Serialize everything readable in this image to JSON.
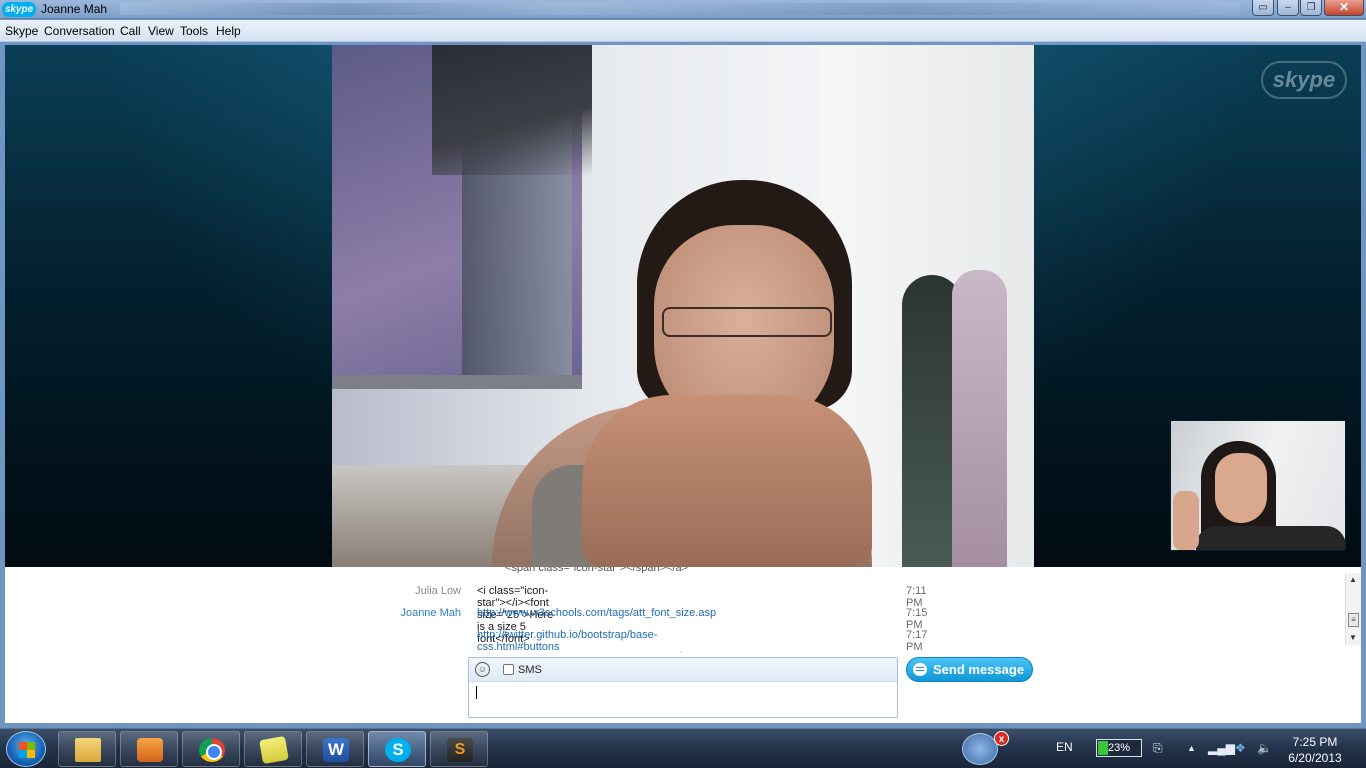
{
  "window": {
    "app_logo": "skype",
    "title": "Joanne Mah",
    "controls": [
      "restore-down-icon",
      "minimize-icon",
      "maximize-icon",
      "close-icon"
    ]
  },
  "menu": [
    "Skype",
    "Conversation",
    "Call",
    "View",
    "Tools",
    "Help"
  ],
  "video": {
    "watermark": "skype"
  },
  "chat": {
    "cut_line": "<span class=\"icon-star\"></span></a>",
    "messages": [
      {
        "sender": "Julia Low",
        "text": "<i class=\"icon-star\"></i><font size=\"25\">Here is a size 5 font</font>",
        "time": "7:11 PM",
        "sender_color": "#8a8a8a",
        "text_color": "#1a1a1a"
      },
      {
        "sender": "Joanne Mah",
        "text": "http://www.w3schools.com/tags/att_font_size.asp",
        "time": "7:15 PM",
        "sender_color": "#2f7fc4",
        "text_color": "#1f6db3"
      },
      {
        "sender": "",
        "text": "http://twitter.github.io/bootstrap/base-css.html#buttons",
        "time": "7:17 PM",
        "sender_color": "#2f7fc4",
        "text_color": "#1f6db3"
      }
    ]
  },
  "compose": {
    "sms_label": "SMS",
    "sms_checked": false,
    "message_value": "",
    "send_label": "Send message"
  },
  "taskbar": {
    "apps": [
      "windows-explorer",
      "media-player",
      "chrome",
      "sticky-notes",
      "word",
      "skype",
      "sublime-text"
    ],
    "word_glyph": "W",
    "skype_glyph": "S",
    "sublime_glyph": "S",
    "tray_badge": "x",
    "language": "EN",
    "battery": "23%",
    "battery_level": 0.23,
    "time": "7:25 PM",
    "date": "6/20/2013"
  }
}
